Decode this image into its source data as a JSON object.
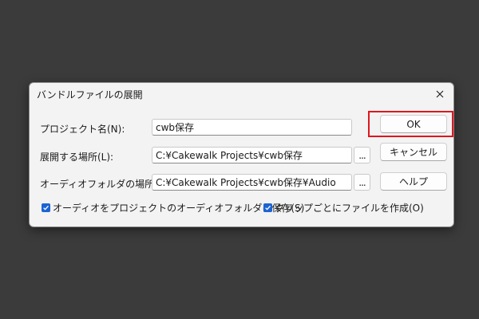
{
  "dialog": {
    "title": "バンドルファイルの展開",
    "close_icon": "close-icon"
  },
  "rows": {
    "project_name_label": "プロジェクト名(N):",
    "project_name_value": "cwb保存",
    "expand_location_label": "展開する場所(L):",
    "expand_location_value": "C:¥Cakewalk Projects¥cwb保存",
    "audio_folder_label": "オーディオフォルダの場所(A):",
    "audio_folder_value": "C:¥Cakewalk Projects¥cwb保存¥Audio",
    "browse_label": "..."
  },
  "buttons": {
    "ok": "OK",
    "cancel": "キャンセル",
    "help": "ヘルプ"
  },
  "checkboxes": {
    "save_audio_in_project": "オーディオをプロジェクトのオーディオフォルダに保存(S)",
    "create_file_per_clip": "クリップごとにファイルを作成(O)"
  },
  "colors": {
    "accent": "#1c64d2",
    "highlight": "#e0161e"
  }
}
